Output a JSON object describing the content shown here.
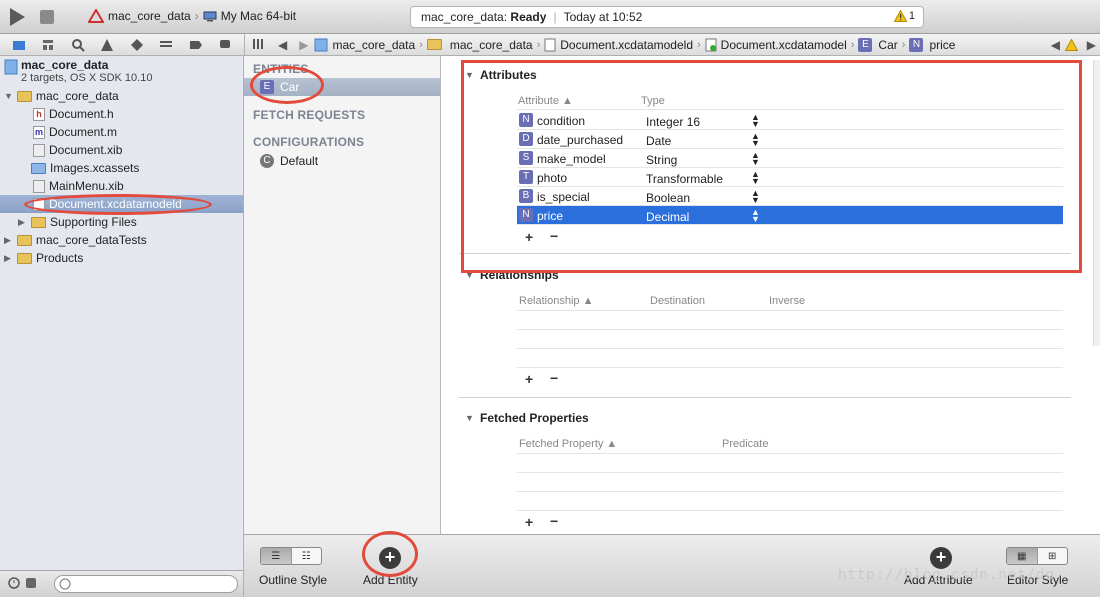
{
  "toolbar": {
    "scheme_name": "mac_core_data",
    "destination": "My Mac 64-bit",
    "status_project": "mac_core_data:",
    "status_state": "Ready",
    "status_time": "Today at 10:52",
    "warning_count": "1"
  },
  "jumpbar": {
    "crumbs": [
      "mac_core_data",
      "mac_core_data",
      "Document.xcdatamodeld",
      "Document.xcdatamodel",
      "Car",
      "price"
    ],
    "crumb_badges": {
      "entity": "E",
      "attribute": "N"
    }
  },
  "navigator": {
    "project_name": "mac_core_data",
    "project_subtitle": "2 targets, OS X SDK 10.10",
    "items": [
      {
        "label": "mac_core_data",
        "badge": ""
      },
      {
        "label": "Document.h",
        "badge": "h"
      },
      {
        "label": "Document.m",
        "badge": "m"
      },
      {
        "label": "Document.xib",
        "badge": ""
      },
      {
        "label": "Images.xcassets",
        "badge": ""
      },
      {
        "label": "MainMenu.xib",
        "badge": ""
      },
      {
        "label": "Document.xcdatamodeld",
        "badge": ""
      },
      {
        "label": "Supporting Files",
        "badge": ""
      },
      {
        "label": "mac_core_dataTests",
        "badge": ""
      },
      {
        "label": "Products",
        "badge": ""
      }
    ]
  },
  "outline": {
    "entities_header": "ENTITIES",
    "entity_badge": "E",
    "entity": "Car",
    "fetch_requests_header": "FETCH REQUESTS",
    "configurations_header": "CONFIGURATIONS",
    "configuration_badge": "C",
    "configuration": "Default"
  },
  "attributes": {
    "title": "Attributes",
    "col_attribute": "Attribute ▲",
    "col_type": "Type",
    "rows": [
      {
        "badge": "N",
        "name": "condition",
        "type": "Integer 16"
      },
      {
        "badge": "D",
        "name": "date_purchased",
        "type": "Date"
      },
      {
        "badge": "S",
        "name": "make_model",
        "type": "String"
      },
      {
        "badge": "T",
        "name": "photo",
        "type": "Transformable"
      },
      {
        "badge": "B",
        "name": "is_special",
        "type": "Boolean"
      },
      {
        "badge": "N",
        "name": "price",
        "type": "Decimal"
      }
    ]
  },
  "relationships": {
    "title": "Relationships",
    "col_relationship": "Relationship ▲",
    "col_destination": "Destination",
    "col_inverse": "Inverse"
  },
  "fetched": {
    "title": "Fetched Properties",
    "col_property": "Fetched Property ▲",
    "col_predicate": "Predicate"
  },
  "bottom": {
    "outline_style": "Outline Style",
    "add_entity": "Add Entity",
    "add_attribute": "Add Attribute",
    "editor_style": "Editor Style",
    "watermark": "http://blog.csdn.net/do"
  },
  "colors": {
    "selection": "#2a6fdb",
    "annotation_red": "#e24a3b",
    "navigator_bg": "#e4e8ee"
  }
}
